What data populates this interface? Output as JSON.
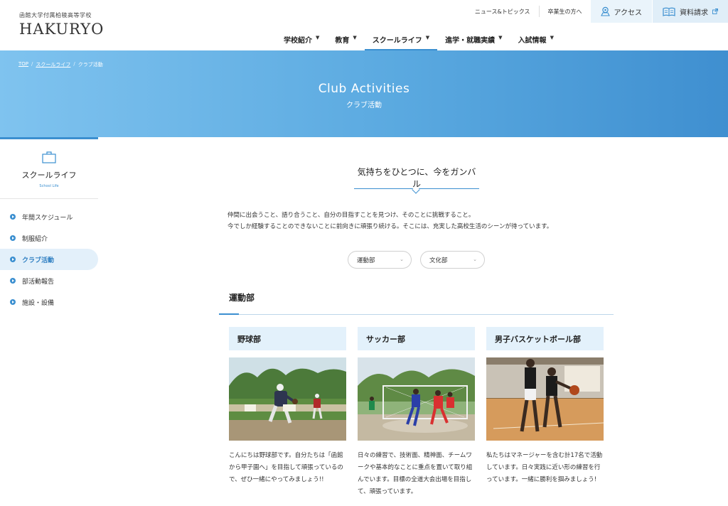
{
  "logo": {
    "subtitle": "函館大学付属柏稜高等学校",
    "name": "HAKURYO"
  },
  "util": {
    "news": "ニュース&トピックス",
    "alumni": "卒業生の方へ",
    "access": "アクセス",
    "brochure": "資料請求"
  },
  "gnav": [
    {
      "label": "学校紹介"
    },
    {
      "label": "教育"
    },
    {
      "label": "スクールライフ"
    },
    {
      "label": "進学・就職実績"
    },
    {
      "label": "入試情報"
    }
  ],
  "breadcrumb": {
    "top": "TOP",
    "parent": "スクールライフ",
    "current": "クラブ活動",
    "sep": "/"
  },
  "hero": {
    "title": "Club Activities",
    "subtitle": "クラブ活動"
  },
  "sidebar": {
    "title": "スクールライフ",
    "subtitle": "School Life",
    "items": [
      {
        "label": "年間スケジュール"
      },
      {
        "label": "制服紹介"
      },
      {
        "label": "クラブ活動"
      },
      {
        "label": "部活動報告"
      },
      {
        "label": "施設・設備"
      }
    ]
  },
  "intro": {
    "heading": "気持ちをひとつに、今をガンバル",
    "line1": "仲間に出会うこと、語り合うこと、自分の目指すことを見つけ、そのことに挑戦すること。",
    "line2": "今でしか経験することのできないことに前向きに頑張り続ける。そこには、充実した高校生活のシーンが待っています。"
  },
  "filters": {
    "sports": "運動部",
    "culture": "文化部"
  },
  "section": {
    "title": "運動部"
  },
  "cards": [
    {
      "title": "野球部",
      "text": "こんにちは野球部です。自分たちは「函館から甲子園へ」を目指して頑張っているので、ぜひ一緒にやってみましょう!!"
    },
    {
      "title": "サッカー部",
      "text": "日々の練習で、技術面、精神面、チームワークや基本的なことに重点を置いて取り組んでいます。目標の全道大会出場を目指して、頑張っています。"
    },
    {
      "title": "男子バスケットボール部",
      "text": "私たちはマネージャーを含む計17名で活動しています。日々実践に近い形の練習を行っています。一緒に勝利を掴みましょう!"
    }
  ],
  "colors": {
    "accent": "#3b8fd0",
    "card_head_bg": "#e3f1fb",
    "hero_start": "#7fc3ef",
    "hero_end": "#3f8fd0"
  }
}
